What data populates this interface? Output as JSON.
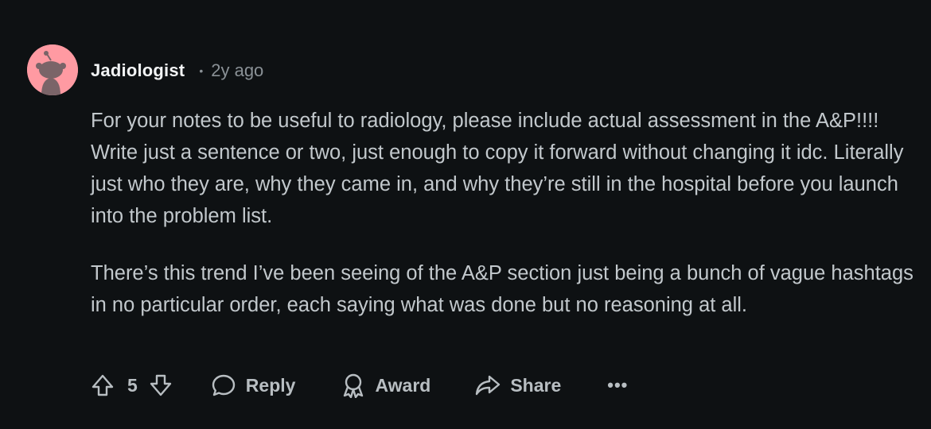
{
  "comment": {
    "author": "Jadiologist",
    "separator": "•",
    "time": "2y ago",
    "body": [
      "For your notes to be useful to radiology, please include actual assessment in the A&P!!!! Write just a sentence or two, just enough to copy it forward without changing it idc. Literally just who they are, why they came in, and why they’re still in the hospital before you launch into the problem list.",
      "There’s this trend I’ve been seeing of the A&P section just being a bunch of vague hashtags in no particular order, each saying what was done but no reasoning at all."
    ],
    "votes": "5",
    "actions": {
      "reply": "Reply",
      "award": "Award",
      "share": "Share",
      "more": "•••"
    }
  },
  "colors": {
    "background": "#0e1113",
    "avatar": "#ff9aa2",
    "text": "#c2c8cc",
    "muted": "#8a9196"
  },
  "icons": [
    "snoo-avatar-icon",
    "upvote-icon",
    "downvote-icon",
    "comment-bubble-icon",
    "award-icon",
    "share-arrow-icon",
    "more-options-icon"
  ]
}
